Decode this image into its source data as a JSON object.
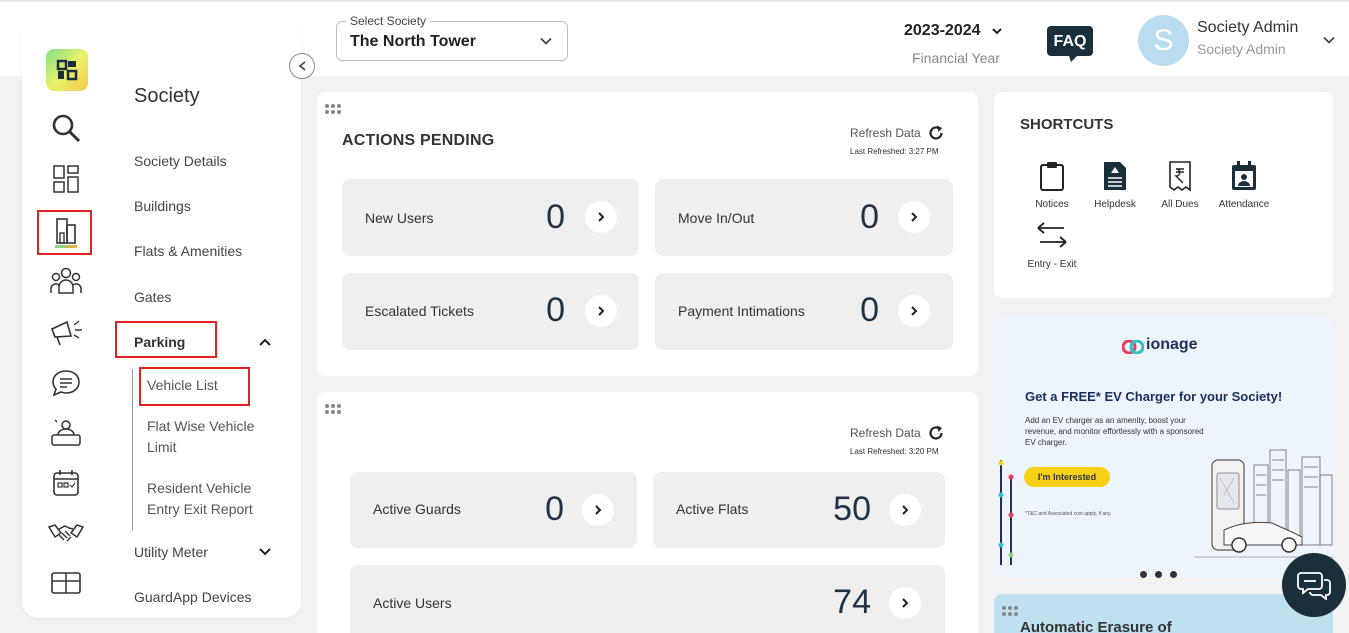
{
  "header": {
    "society_select_legend": "Select Society",
    "society_select_value": "The North Tower",
    "financial_year": "2023-2024",
    "financial_year_label": "Financial Year",
    "faq_label": "FAQ",
    "avatar_initial": "S",
    "user_name": "Society Admin",
    "user_role": "Society Admin"
  },
  "rail": {
    "icons": [
      "logo-icon",
      "search-icon",
      "dashboard-icon",
      "building-icon",
      "people-icon",
      "announcement-icon",
      "chat-icon",
      "helpdesk-icon",
      "calendar-icon",
      "handshake-icon",
      "package-icon"
    ]
  },
  "menu": {
    "title": "Society",
    "items": {
      "society_details": "Society Details",
      "buildings": "Buildings",
      "flats_amenities": "Flats & Amenities",
      "gates": "Gates",
      "parking": "Parking",
      "utility_meter": "Utility Meter",
      "guardapp_devices": "GuardApp Devices"
    },
    "parking_sub": {
      "vehicle_list": "Vehicle List",
      "flat_wise_vehicle_limit": "Flat Wise Vehicle Limit",
      "resident_vehicle_report": "Resident Vehicle Entry Exit Report"
    }
  },
  "actions_pending": {
    "title": "ACTIONS PENDING",
    "refresh_label": "Refresh Data",
    "last_refreshed": "Last Refreshed: 3:27 PM",
    "tiles": {
      "new_users": {
        "label": "New Users",
        "value": "0"
      },
      "move_in_out": {
        "label": "Move In/Out",
        "value": "0"
      },
      "escalated_tickets": {
        "label": "Escalated Tickets",
        "value": "0"
      },
      "payment_intimations": {
        "label": "Payment Intimations",
        "value": "0"
      }
    }
  },
  "stats": {
    "refresh_label": "Refresh Data",
    "last_refreshed": "Last Refreshed: 3:20 PM",
    "tiles": {
      "active_guards": {
        "label": "Active Guards",
        "value": "0"
      },
      "active_flats": {
        "label": "Active Flats",
        "value": "50"
      },
      "active_users": {
        "label": "Active Users",
        "value": "74"
      }
    }
  },
  "shortcuts": {
    "title": "SHORTCUTS",
    "items": {
      "notices": "Notices",
      "helpdesk": "Helpdesk",
      "all_dues": "All Dues",
      "attendance": "Attendance",
      "entry_exit": "Entry - Exit"
    }
  },
  "ad": {
    "brand": "ionage",
    "headline": "Get a FREE* EV Charger for your Society!",
    "body": "Add an EV charger as an amenity, boost your revenue, and monitor effortlessly with a sponsored EV charger.",
    "button": "I'm Interested",
    "note": "*T&C and Associated cost apply, if any."
  },
  "erasure": {
    "title": "Automatic Erasure of"
  },
  "colors": {
    "highlight": "#e02424",
    "number": "#1f3244",
    "ad_button": "#f7d117",
    "chat_fab": "#1b2f3b"
  }
}
